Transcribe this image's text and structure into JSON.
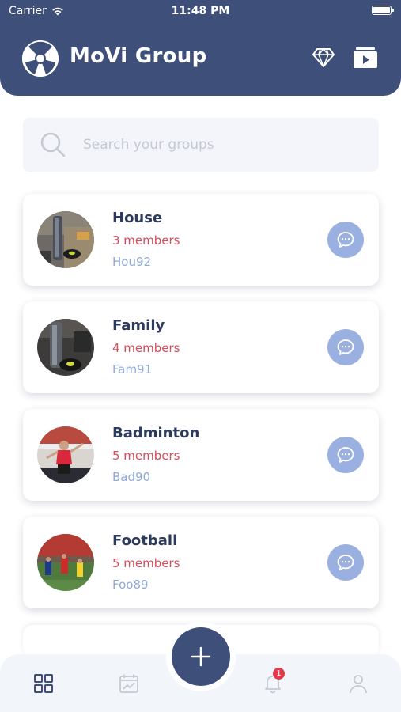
{
  "status_bar": {
    "carrier": "Carrier",
    "time": "11:48 PM"
  },
  "header": {
    "title": "MoVi Group"
  },
  "search": {
    "placeholder": "Search your groups"
  },
  "groups": [
    {
      "name": "House",
      "members": "3 members",
      "code": "Hou92"
    },
    {
      "name": "Family",
      "members": "4 members",
      "code": "Fam91"
    },
    {
      "name": "Badminton",
      "members": "5 members",
      "code": "Bad90"
    },
    {
      "name": "Football",
      "members": "5 members",
      "code": "Foo89"
    }
  ],
  "bottom_nav": {
    "items": [
      "groups-icon",
      "activity-icon",
      "notifications-icon",
      "profile-icon"
    ],
    "notification_count": "1",
    "fab_icon": "plus-icon"
  },
  "colors": {
    "primary": "#3e5079",
    "members_text": "#d94a5b",
    "code_text": "#8fa9d8",
    "chat_button": "#9ab0e0",
    "badge": "#e5394b"
  }
}
